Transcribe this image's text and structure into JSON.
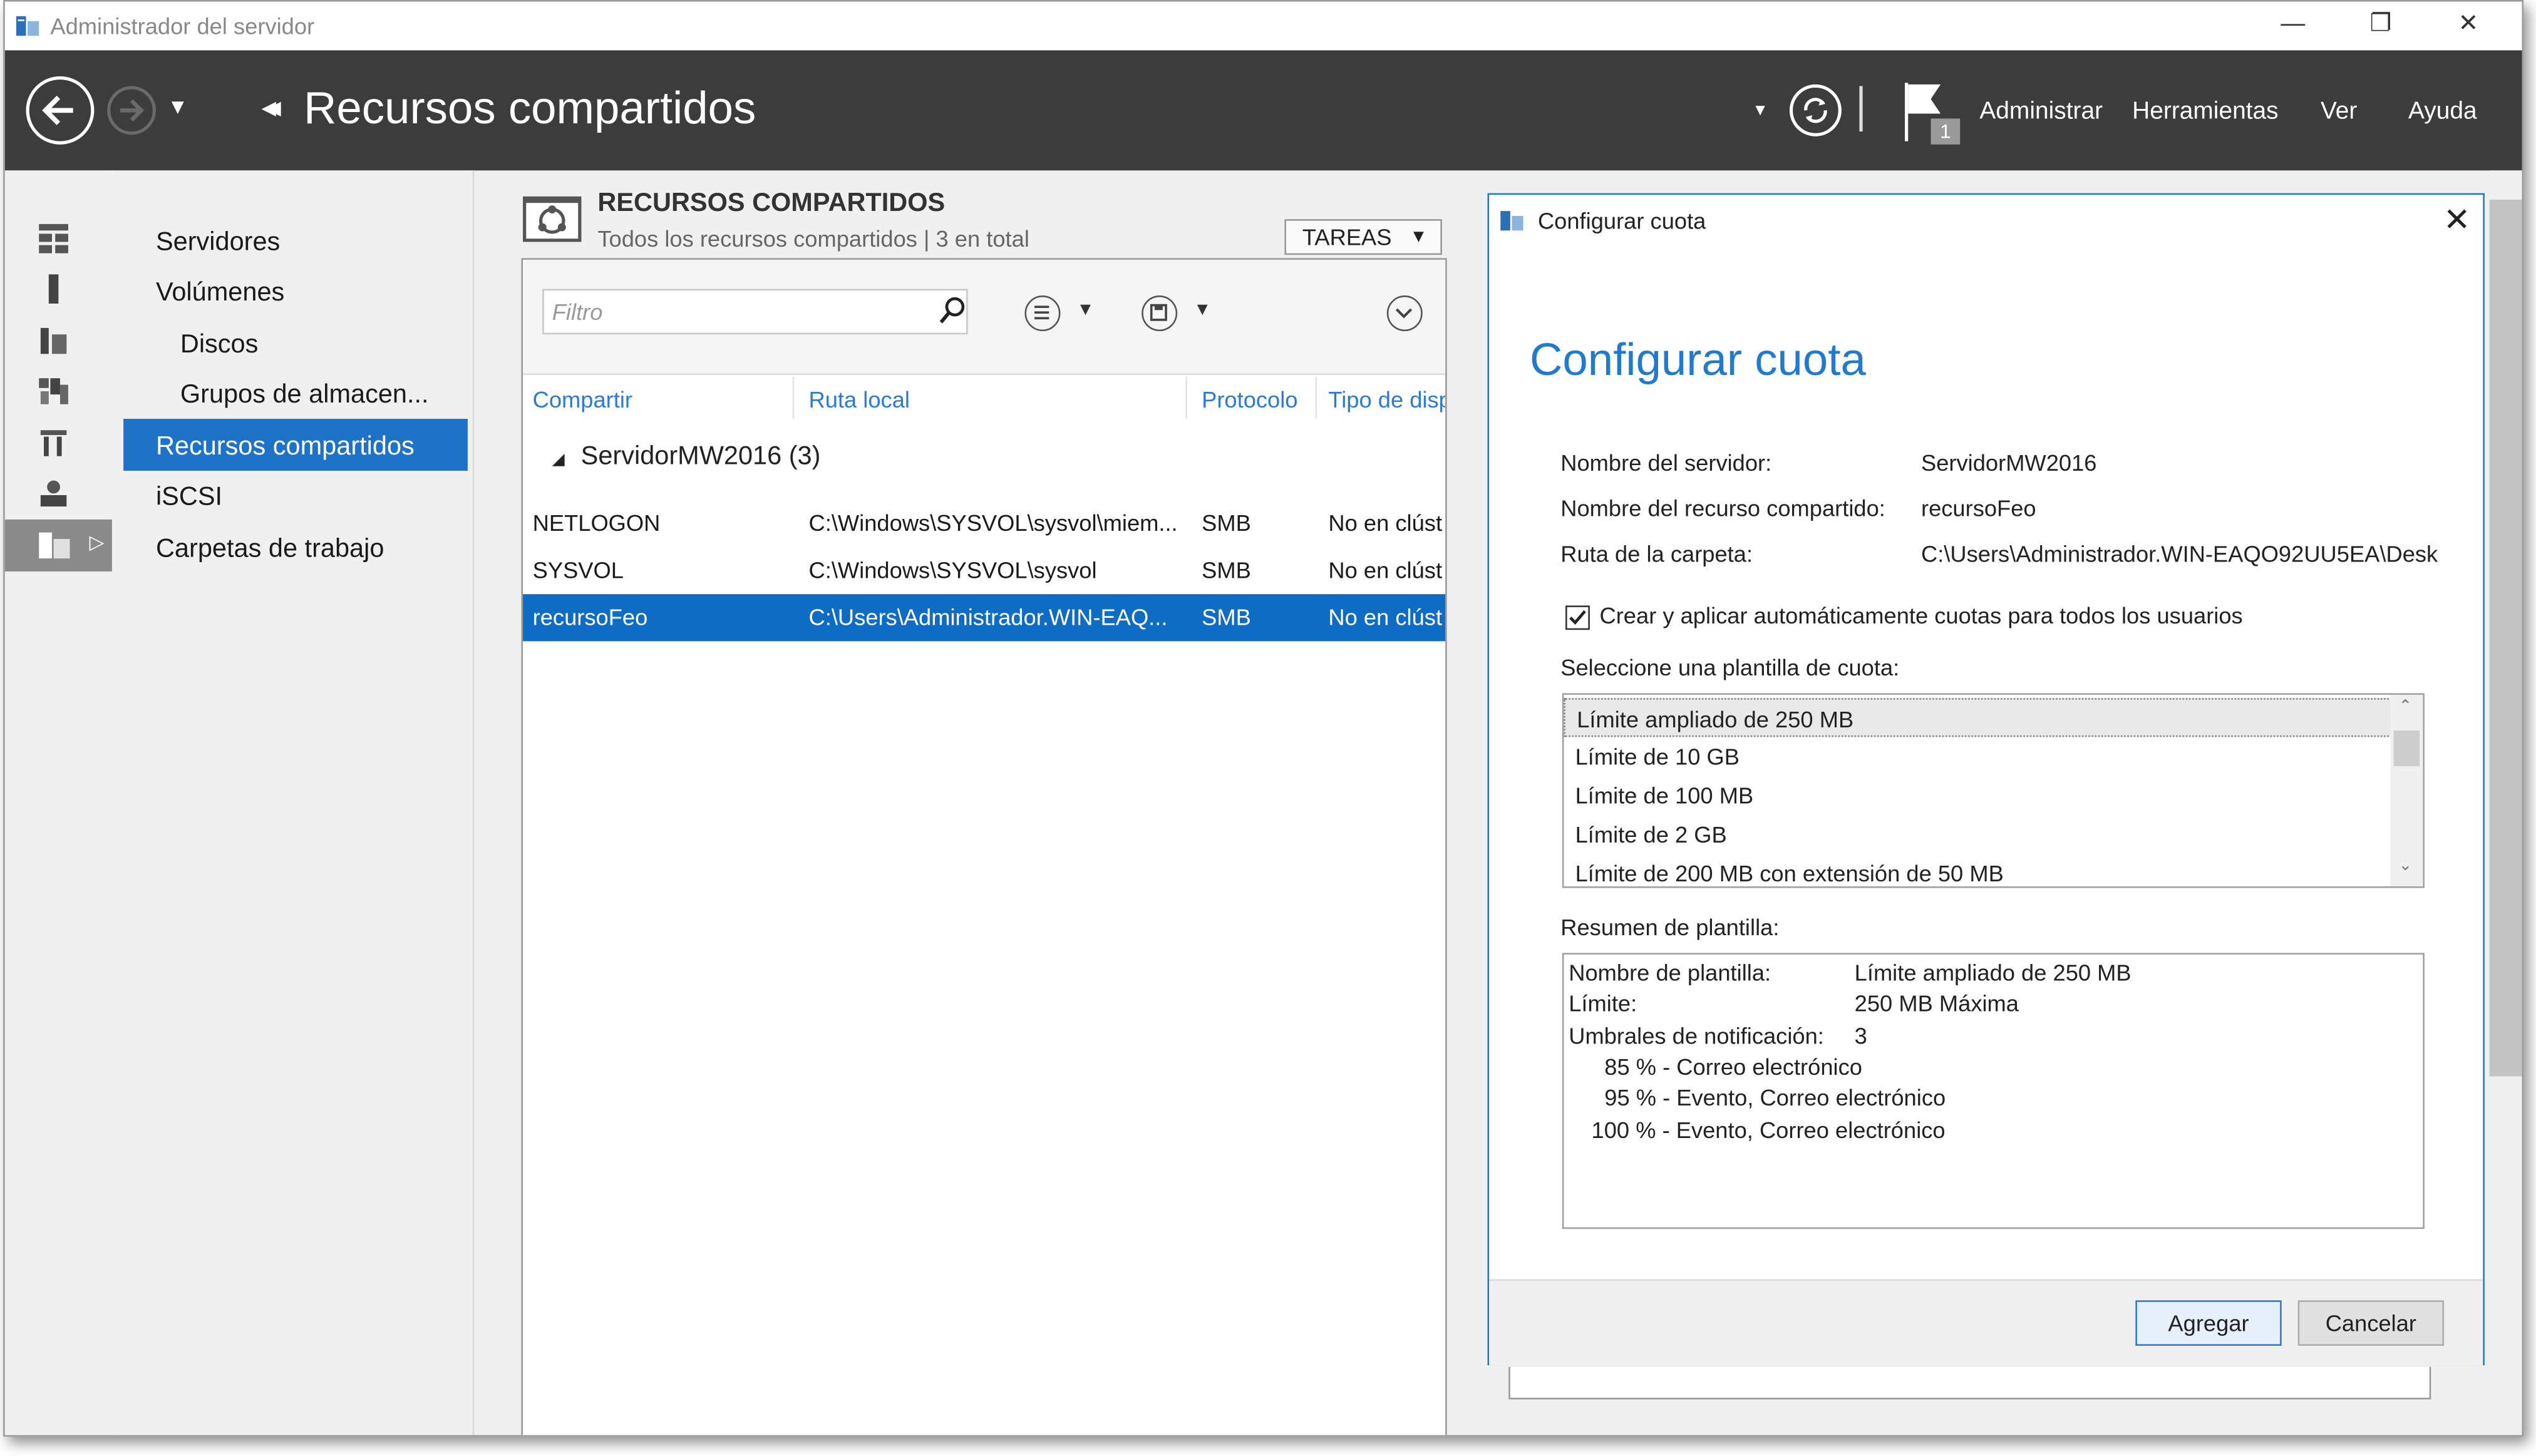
{
  "window": {
    "title": "Administrador del servidor",
    "controls": {
      "minimize": "—",
      "restore": "❐",
      "close": "✕"
    }
  },
  "header": {
    "page_title": "Recursos compartidos",
    "menu": [
      "Administrar",
      "Herramientas",
      "Ver",
      "Ayuda"
    ],
    "notification_count": "1"
  },
  "nav": {
    "items": [
      {
        "label": "Servidores"
      },
      {
        "label": "Volúmenes"
      },
      {
        "label": "Discos"
      },
      {
        "label": "Grupos de almacen..."
      },
      {
        "label": "Recursos compartidos"
      },
      {
        "label": "iSCSI"
      },
      {
        "label": "Carpetas de trabajo"
      }
    ],
    "selected": "Recursos compartidos"
  },
  "shares": {
    "title": "RECURSOS COMPARTIDOS",
    "subtitle": "Todos los recursos compartidos | 3 en total",
    "tasks_label": "TAREAS",
    "filter_placeholder": "Filtro",
    "columns": [
      "Compartir",
      "Ruta local",
      "Protocolo",
      "Tipo de disp"
    ],
    "group": "ServidorMW2016 (3)",
    "rows": [
      {
        "share": "NETLOGON",
        "path": "C:\\Windows\\SYSVOL\\sysvol\\miem...",
        "protocol": "SMB",
        "type": "No en clúst"
      },
      {
        "share": "SYSVOL",
        "path": "C:\\Windows\\SYSVOL\\sysvol",
        "protocol": "SMB",
        "type": "No en clúst"
      },
      {
        "share": "recursoFeo",
        "path": "C:\\Users\\Administrador.WIN-EAQ...",
        "protocol": "SMB",
        "type": "No en clúst"
      }
    ],
    "selected_row": "recursoFeo"
  },
  "dialog": {
    "window_title": "Configurar cuota",
    "heading": "Configurar cuota",
    "server_label": "Nombre del servidor:",
    "server_value": "ServidorMW2016",
    "share_label": "Nombre del recurso compartido:",
    "share_value": "recursoFeo",
    "path_label": "Ruta de la carpeta:",
    "path_value": "C:\\Users\\Administrador.WIN-EAQO92UU5EA\\Desk",
    "auto_apply_label": "Crear y aplicar automáticamente cuotas para todos los usuarios",
    "auto_apply_checked": true,
    "template_label": "Seleccione una plantilla de cuota:",
    "templates": [
      "Límite ampliado de 250 MB",
      "Límite de 10 GB",
      "Límite de 100 MB",
      "Límite de 2 GB",
      "Límite de 200 MB con extensión de 50 MB"
    ],
    "selected_template": "Límite ampliado de 250 MB",
    "summary_label": "Resumen de plantilla:",
    "summary": {
      "name_label": "Nombre de plantilla:",
      "name_value": "Límite ampliado de 250 MB",
      "limit_label": "Límite:",
      "limit_value": "250 MB Máxima",
      "thresholds_label": "Umbrales de notificación:",
      "thresholds_value": "3",
      "thresholds": [
        "85 % - Correo electrónico",
        "95 % - Evento, Correo electrónico",
        "100 % - Evento, Correo electrónico"
      ]
    },
    "add_button": "Agregar",
    "cancel_button": "Cancelar"
  },
  "colors": {
    "header_bg": "#3c3c3c",
    "selection": "#1e73c8",
    "accent_text": "#1f7ad0"
  }
}
